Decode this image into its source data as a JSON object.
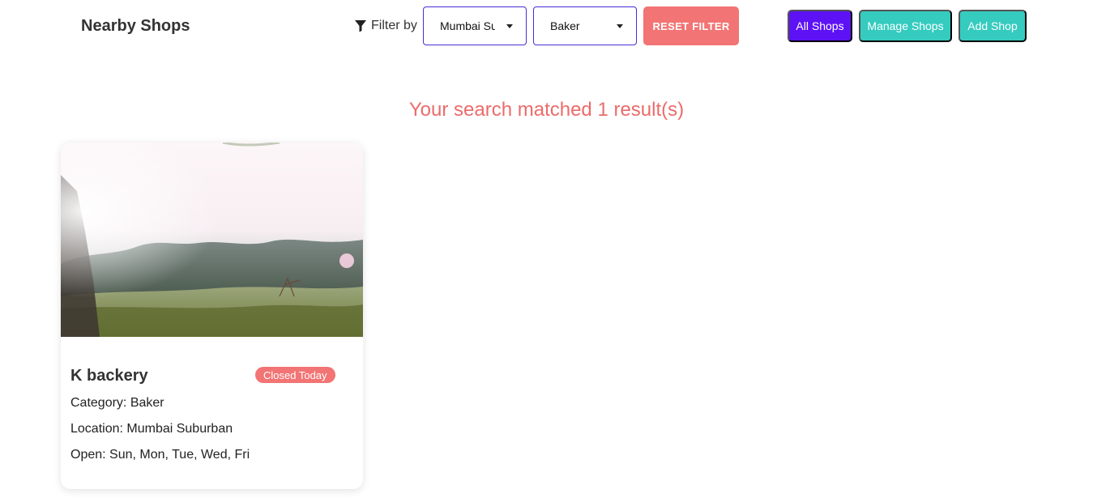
{
  "header": {
    "brand": "Nearby Shops",
    "filter_label": "Filter by",
    "location_select": {
      "value": "Mumbai Suburban"
    },
    "category_select": {
      "value": "Baker"
    },
    "reset_label": "RESET FILTER",
    "nav_buttons": {
      "all": "All Shops",
      "manage": "Manage Shops",
      "add": "Add Shop"
    }
  },
  "results": {
    "summary": "Your search matched 1 result(s)",
    "shops": [
      {
        "name": "K backery",
        "status": "Closed Today",
        "category": "Category: Baker",
        "location": "Location: Mumbai Suburban",
        "open": "Open: Sun, Mon, Tue, Wed, Fri"
      }
    ]
  },
  "colors": {
    "accent_purple": "#5d12f5",
    "accent_teal": "#35cbbf",
    "accent_red": "#f27474"
  },
  "icons": {
    "filter": "filter-funnel-icon",
    "dropdown": "chevron-down-icon"
  }
}
